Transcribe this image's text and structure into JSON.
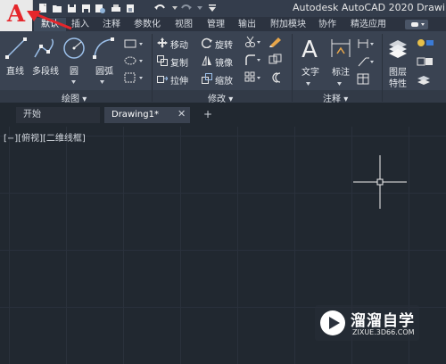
{
  "window": {
    "title": "Autodesk AutoCAD 2020    Drawi"
  },
  "app_button": {
    "letter": "A"
  },
  "quick_access": [
    "new-icon",
    "open-icon",
    "save-icon",
    "save-as-icon",
    "web-save-icon",
    "plot-icon",
    "undo-icon",
    "redo-icon",
    "dropdown-icon"
  ],
  "menu": {
    "tabs": [
      "默认",
      "插入",
      "注释",
      "参数化",
      "视图",
      "管理",
      "输出",
      "附加模块",
      "协作",
      "精选应用"
    ]
  },
  "ribbon": {
    "draw": {
      "title": "绘图",
      "line": "直线",
      "polyline": "多段线",
      "circle": "圆",
      "arc": "圆弧"
    },
    "modify": {
      "title": "修改",
      "move": "移动",
      "rotate": "旋转",
      "copy": "复制",
      "mirror": "镜像",
      "stretch": "拉伸",
      "scale": "缩放"
    },
    "annotation": {
      "title": "注释",
      "text": "文字",
      "dimension": "标注"
    },
    "layers": {
      "title": "图层\n特性",
      "line1": "图层",
      "line2": "特性"
    }
  },
  "documents": {
    "tabs": [
      "开始",
      "Drawing1*"
    ],
    "close": "✕",
    "add": "+"
  },
  "viewport": {
    "label": "[−][俯视][二维线框]"
  },
  "watermark": {
    "title": "溜溜自学",
    "url": "ZIXUE.3D66.COM"
  },
  "colors": {
    "accent_red": "#e5262b",
    "ribbon_bg": "#3a4352",
    "canvas_bg": "#212830"
  }
}
